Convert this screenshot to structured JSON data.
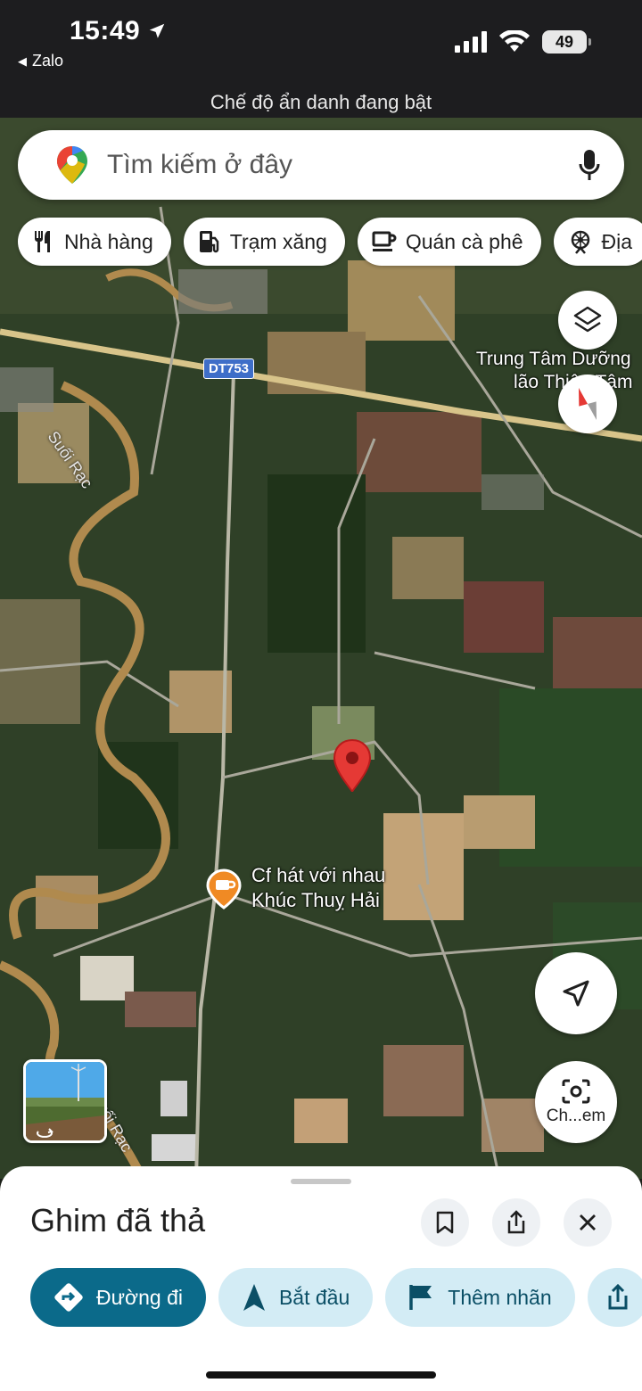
{
  "status_bar": {
    "time": "15:49",
    "back_app": "Zalo",
    "battery": "49",
    "banner": "Chế độ ẩn danh đang bật"
  },
  "search": {
    "placeholder": "Tìm kiếm ở đây"
  },
  "chips": [
    {
      "label": "Nhà hàng",
      "icon": "fork-knife-icon"
    },
    {
      "label": "Trạm xăng",
      "icon": "gas-pump-icon"
    },
    {
      "label": "Quán cà phê",
      "icon": "coffee-cup-icon"
    },
    {
      "label": "Địa",
      "icon": "attraction-icon"
    }
  ],
  "map": {
    "road_shield": "DT753",
    "poi_label_line1": "Trung Tâm Dưỡng",
    "poi_label_line2": "lão Thiện Tâm",
    "stream_label_1": "Suối Rạc",
    "stream_label_2": "Suối Rạc",
    "cafe_line1": "Cf hát với nhau",
    "cafe_line2": "Khúc Thuỵ Hải",
    "lens_label": "Ch...em"
  },
  "sheet": {
    "title": "Ghim đã thả",
    "actions": [
      {
        "label": "Đường đi",
        "icon": "directions-icon"
      },
      {
        "label": "Bắt đầu",
        "icon": "navigation-arrow-icon"
      },
      {
        "label": "Thêm nhãn",
        "icon": "flag-icon"
      }
    ]
  },
  "colors": {
    "pin": "#e53935",
    "primary_action": "#0b6a8a",
    "secondary_action": "#d3ecf5"
  }
}
